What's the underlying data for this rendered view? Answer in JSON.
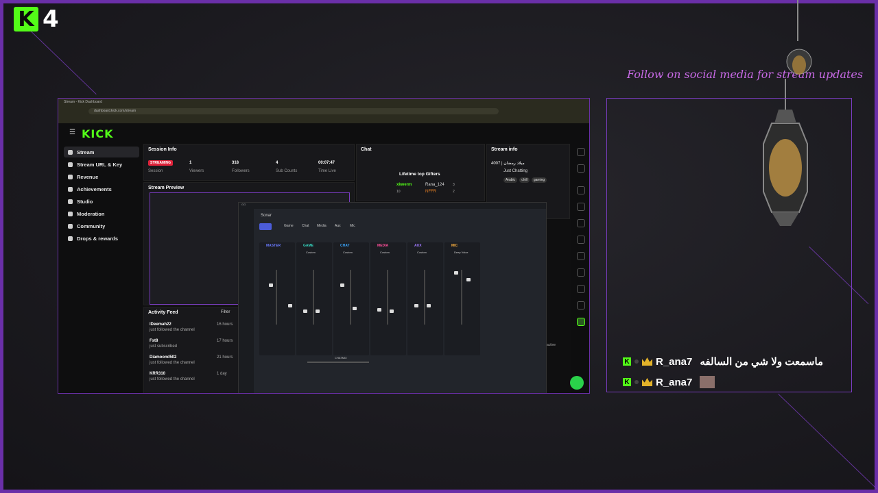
{
  "overlay": {
    "logo_letter": "K",
    "logo_number": "4",
    "follow_text": "Follow on social media for stream updates",
    "chat_messages": [
      {
        "user": "R_ana7",
        "text": "ماسمعت ولا شي من السالفه"
      },
      {
        "user": "R_ana7",
        "text": ""
      }
    ]
  },
  "browser": {
    "tab_title": "Stream - Kick Dashboard",
    "url": "dashboard.kick.com/stream"
  },
  "kick": {
    "logo": "KICK",
    "sidebar": [
      {
        "label": "Stream",
        "active": true
      },
      {
        "label": "Stream URL & Key"
      },
      {
        "label": "Revenue"
      },
      {
        "label": "Achievements"
      },
      {
        "label": "Studio"
      },
      {
        "label": "Moderation"
      },
      {
        "label": "Community"
      },
      {
        "label": "Drops & rewards"
      }
    ],
    "session_info": {
      "title": "Session Info",
      "status": "STREAMING",
      "status_label": "Session",
      "stats": [
        {
          "value": "1",
          "label": "Viewers"
        },
        {
          "value": "318",
          "label": "Followers"
        },
        {
          "value": "4",
          "label": "Sub Counts"
        },
        {
          "value": "00:07:47",
          "label": "Time Live"
        }
      ]
    },
    "stream_preview": {
      "title": "Stream Preview"
    },
    "activity_feed": {
      "title": "Activity Feed",
      "filter": "Filter",
      "items": [
        {
          "name": "lDeemah22",
          "action": "just followed the channel",
          "time": "16 hours"
        },
        {
          "name": "Fst8",
          "action": "just subscribed",
          "time": "17 hours"
        },
        {
          "name": "Diamoond502",
          "action": "just followed the channel",
          "time": "21 hours"
        },
        {
          "name": "KRR310",
          "action": "just followed the channel",
          "time": "1 day"
        }
      ]
    },
    "chat": {
      "title": "Chat",
      "gifters_title": "Lifetime top Gifters",
      "gifters": [
        {
          "name": "xkwerm",
          "count": "10"
        },
        {
          "name": "Rana_124",
          "count": "3"
        },
        {
          "name": "NFFR",
          "count": "2"
        }
      ]
    },
    "stream_info": {
      "title": "Stream info",
      "stream_title": "4007 | ميلاد رمضان",
      "category": "Just Chatting",
      "tags": [
        "Arabic",
        "chill",
        "gaming"
      ]
    },
    "extra_text": "active"
  },
  "sonar": {
    "app_title": "GG",
    "header": "Sonar",
    "tabs": [
      "Game",
      "Chat",
      "Media",
      "Aux",
      "Mic"
    ],
    "channels": [
      {
        "label": "MASTER",
        "preset": "",
        "color": "#6a7bff"
      },
      {
        "label": "GAME",
        "preset": "Custom",
        "color": "#36d6c0"
      },
      {
        "label": "CHAT",
        "preset": "Custom",
        "color": "#3aa8ff"
      },
      {
        "label": "MEDIA",
        "preset": "Custom",
        "color": "#ff4f9a"
      },
      {
        "label": "AUX",
        "preset": "Custom",
        "color": "#a07aff"
      },
      {
        "label": "MIC",
        "preset": "Deep Voice",
        "color": "#ffb340"
      }
    ],
    "chatmix_label": "CHATMIX"
  }
}
